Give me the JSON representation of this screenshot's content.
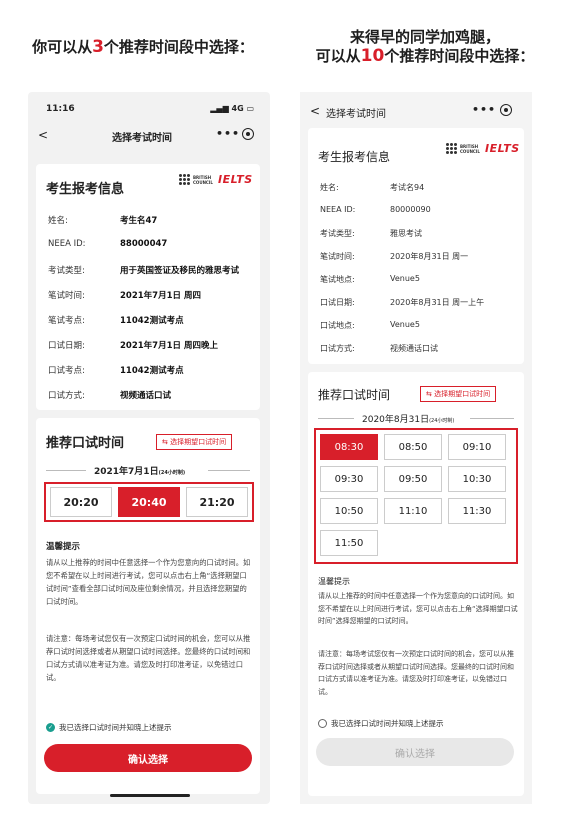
{
  "headline_left": {
    "pre": "你可以从",
    "num": "3",
    "post": "个推荐时间段中选择："
  },
  "headline_right": {
    "line1": "来得早的同学加鸡腿，",
    "pre": "可以从",
    "num": "10",
    "post": "个推荐时间段中选择："
  },
  "left": {
    "status_time": "11:16",
    "status_signal": "4G",
    "nav_back": "<",
    "nav_title": "选择考试时间",
    "nav_more": "•••",
    "brand_bc": "BRITISH COUNCIL",
    "brand_name": "IELTS",
    "info_title": "考生报考信息",
    "info_rows": [
      {
        "k": "姓名:",
        "v": "考生名47"
      },
      {
        "k": "NEEA ID:",
        "v": "88000047"
      },
      {
        "k": "考试类型:",
        "v": "用于英国签证及移民的雅思考试"
      },
      {
        "k": "笔试时间:",
        "v": "2021年7月1日 周四"
      },
      {
        "k": "笔试考点:",
        "v": "11042测试考点"
      },
      {
        "k": "口试日期:",
        "v": "2021年7月1日 周四晚上"
      },
      {
        "k": "口试考点:",
        "v": "11042测试考点"
      },
      {
        "k": "口试方式:",
        "v": "视频通话口试"
      }
    ],
    "rec_title": "推荐口试时间",
    "select_btn": "⇆ 选择期望口试时间",
    "date": "2021年7月1日",
    "date_note": "(24小时制)",
    "slots": [
      "20:20",
      "20:40",
      "21:20"
    ],
    "active_slot": "20:40",
    "tip_title": "温馨提示",
    "tip1": "请从以上推荐的时间中任意选择一个作为您意向的口试时间。如您不希望在以上时间进行考试，您可以点击右上角“选择期望口试时间”查看全部口试时间及座位剩余情况，并且选择您期望的口试时间。",
    "tip2": "请注意：每场考试您仅有一次预定口试时间的机会，您可以从推荐口试时间选择或者从期望口试时间选择。您最终的口试时间和口试方式请以准考证为准。请您及时打印准考证，以免错过口试。",
    "check_label": "我已选择口试时间并知晓上述提示",
    "confirm": "确认选择"
  },
  "right": {
    "nav_back": "<",
    "nav_title": "选择考试时间",
    "nav_more": "•••",
    "brand_bc": "BRITISH COUNCIL",
    "brand_name": "IELTS",
    "info_title": "考生报考信息",
    "info_rows": [
      {
        "k": "姓名:",
        "v": "考试名94"
      },
      {
        "k": "NEEA ID:",
        "v": "80000090"
      },
      {
        "k": "考试类型:",
        "v": "雅思考试"
      },
      {
        "k": "笔试时间:",
        "v": "2020年8月31日 周一"
      },
      {
        "k": "笔试地点:",
        "v": "Venue5"
      },
      {
        "k": "口试日期:",
        "v": "2020年8月31日 周一上午"
      },
      {
        "k": "口试地点:",
        "v": "Venue5"
      },
      {
        "k": "口试方式:",
        "v": "视频通话口试"
      }
    ],
    "rec_title": "推荐口试时间",
    "select_btn": "⇆ 选择期望口试时间",
    "date": "2020年8月31日",
    "date_note": "(24小时制)",
    "slots": [
      "08:30",
      "08:50",
      "09:10",
      "09:30",
      "09:50",
      "10:30",
      "10:50",
      "11:10",
      "11:30",
      "11:50"
    ],
    "active_slot": "08:30",
    "tip_title": "温馨提示",
    "tip1": "请从以上推荐的时间中任意选择一个作为您意向的口试时间。如您不希望在以上时间进行考试，您可以点击右上角“选择期望口试时间”选择您期望的口试时间。",
    "tip2": "请注意：每场考试您仅有一次预定口试时间的机会，您可以从推荐口试时间选择或者从期望口试时间选择。您最终的口试时间和口试方式请以准考证为准。请您及时打印准考证，以免错过口试。",
    "check_label": "我已选择口试时间并知晓上述提示",
    "confirm": "确认选择"
  },
  "colors": {
    "accent": "#d81f2a",
    "check": "#1a9e8f"
  }
}
